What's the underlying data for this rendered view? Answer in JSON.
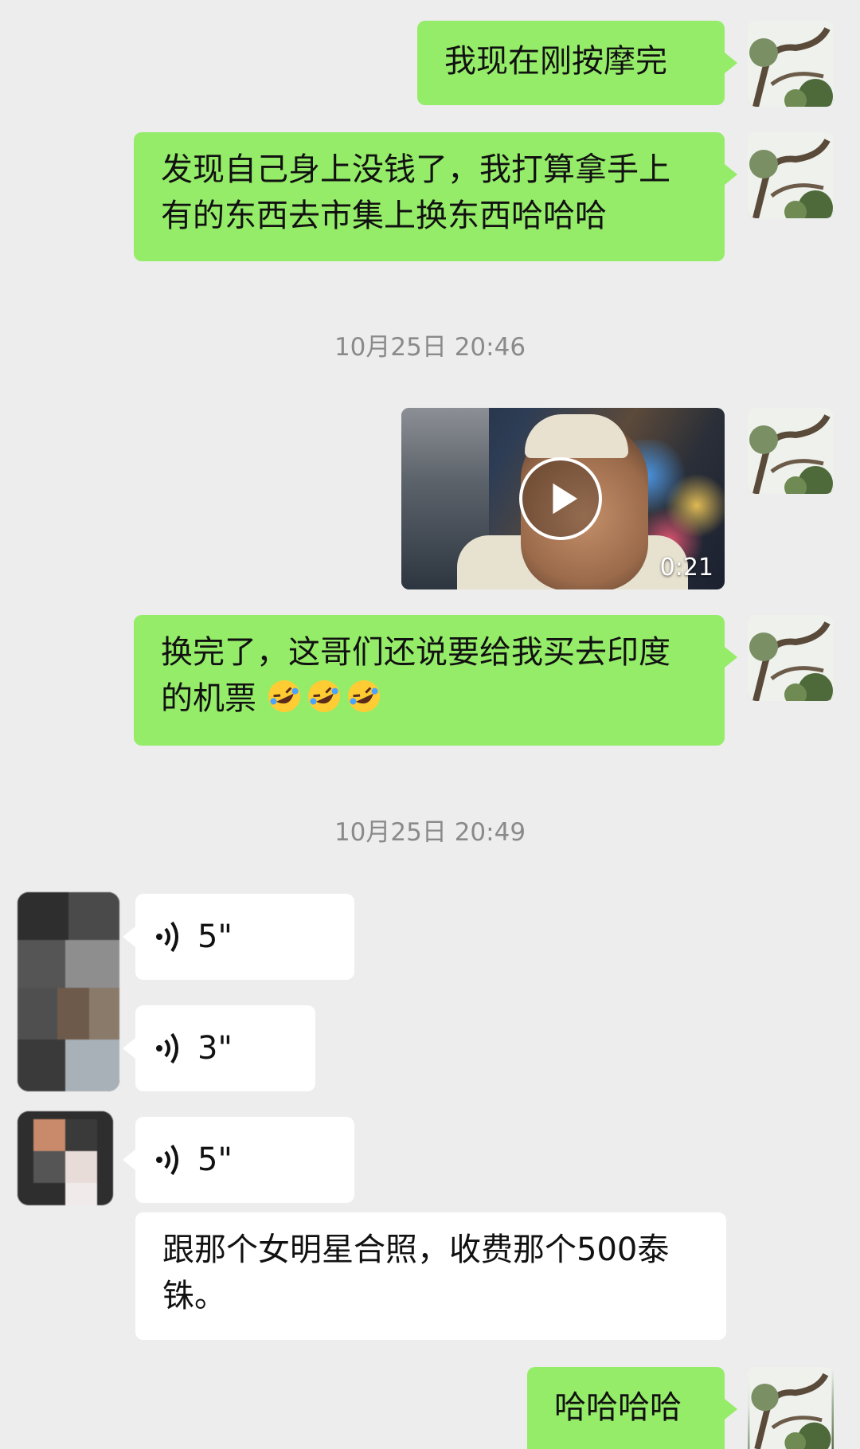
{
  "chat": {
    "messages": [
      {
        "text": "我现在刚按摩完"
      },
      {
        "text": "发现自己身上没钱了，我打算拿手上有的东西去市集上换东西哈哈哈"
      },
      {
        "timestamp": "10月25日 20:46"
      },
      {
        "video_duration": "0:21"
      },
      {
        "text": "换完了，这哥们还说要给我买去印度的机票",
        "emoji_name": "rolling-on-floor-laughing-emoji",
        "emoji_count": 3
      },
      {
        "timestamp": "10月25日 20:49"
      },
      {
        "voice_duration": "5\""
      },
      {
        "voice_duration": "3\""
      },
      {
        "voice_duration": "5\""
      },
      {
        "text": "跟那个女明星合照，收费那个500泰铢。"
      },
      {
        "text": "哈哈哈哈"
      }
    ]
  },
  "colors": {
    "background": "#ededed",
    "self_bubble": "#95ec69",
    "other_bubble": "#ffffff",
    "timestamp": "#8a8a8a"
  }
}
